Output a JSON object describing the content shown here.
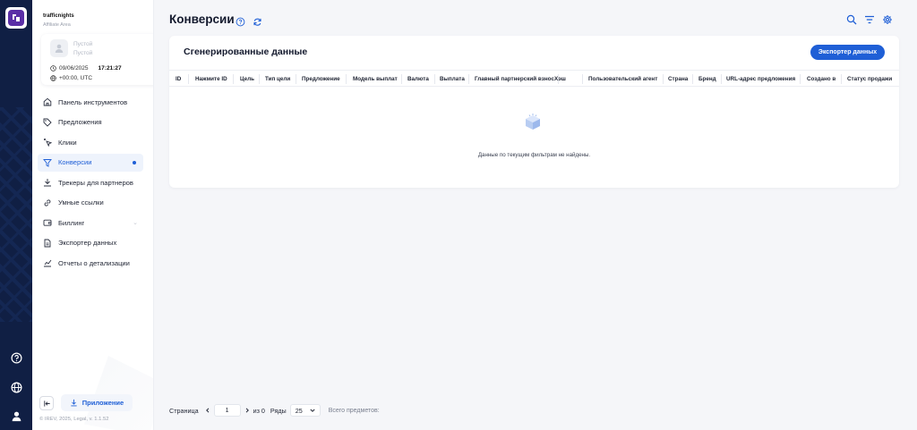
{
  "app": {
    "brand": "trafficnights",
    "brand_sub": "Affiliate Area"
  },
  "user": {
    "line1": "Пустой",
    "line2": "Пустой",
    "date": "09/06/2025",
    "time": "17:21:27",
    "timezone": "+00:00, UTC"
  },
  "sidebar": {
    "items": [
      {
        "label": "Панель инструментов",
        "icon": "home-icon"
      },
      {
        "label": "Предложения",
        "icon": "tag-icon"
      },
      {
        "label": "Клики",
        "icon": "cursor-click-icon"
      },
      {
        "label": "Конверсии",
        "icon": "funnel-icon",
        "active": true
      },
      {
        "label": "Трекеры для партнеров",
        "icon": "tracker-icon"
      },
      {
        "label": "Умные ссылки",
        "icon": "link-icon"
      },
      {
        "label": "Биллинг",
        "icon": "wallet-icon"
      },
      {
        "label": "Экспортер данных",
        "icon": "document-export-icon"
      },
      {
        "label": "Отчеты о детализации",
        "icon": "chart-icon"
      }
    ],
    "app_button": "Приложение",
    "footer": "© IREV, 2025, Legal, v. 1.1.52"
  },
  "page": {
    "title": "Конверсии"
  },
  "panel": {
    "title": "Сгенерированные данные",
    "export_button": "Экспортер данных",
    "columns": [
      "ID",
      "Нажмите ID",
      "Цель",
      "Тип цели",
      "Предложение",
      "Модель выплат",
      "Валюта",
      "Выплата",
      "Главный партнерский взнос",
      "Хэш",
      "Пользовательский агент",
      "Страна",
      "Бренд",
      "URL-адрес предложения",
      "Создано в",
      "Статус продажи"
    ],
    "empty_text": "Данные по текущим фильтрам не найдены."
  },
  "pagination": {
    "page_label": "Страница",
    "page_value": "1",
    "of_label": "из 0",
    "rows_label": "Ряды",
    "rows_value": "25",
    "total_label": "Всего предметов:"
  },
  "colors": {
    "accent": "#1f5fd6",
    "rail": "#101f44",
    "logo": "#5a2ea6"
  }
}
